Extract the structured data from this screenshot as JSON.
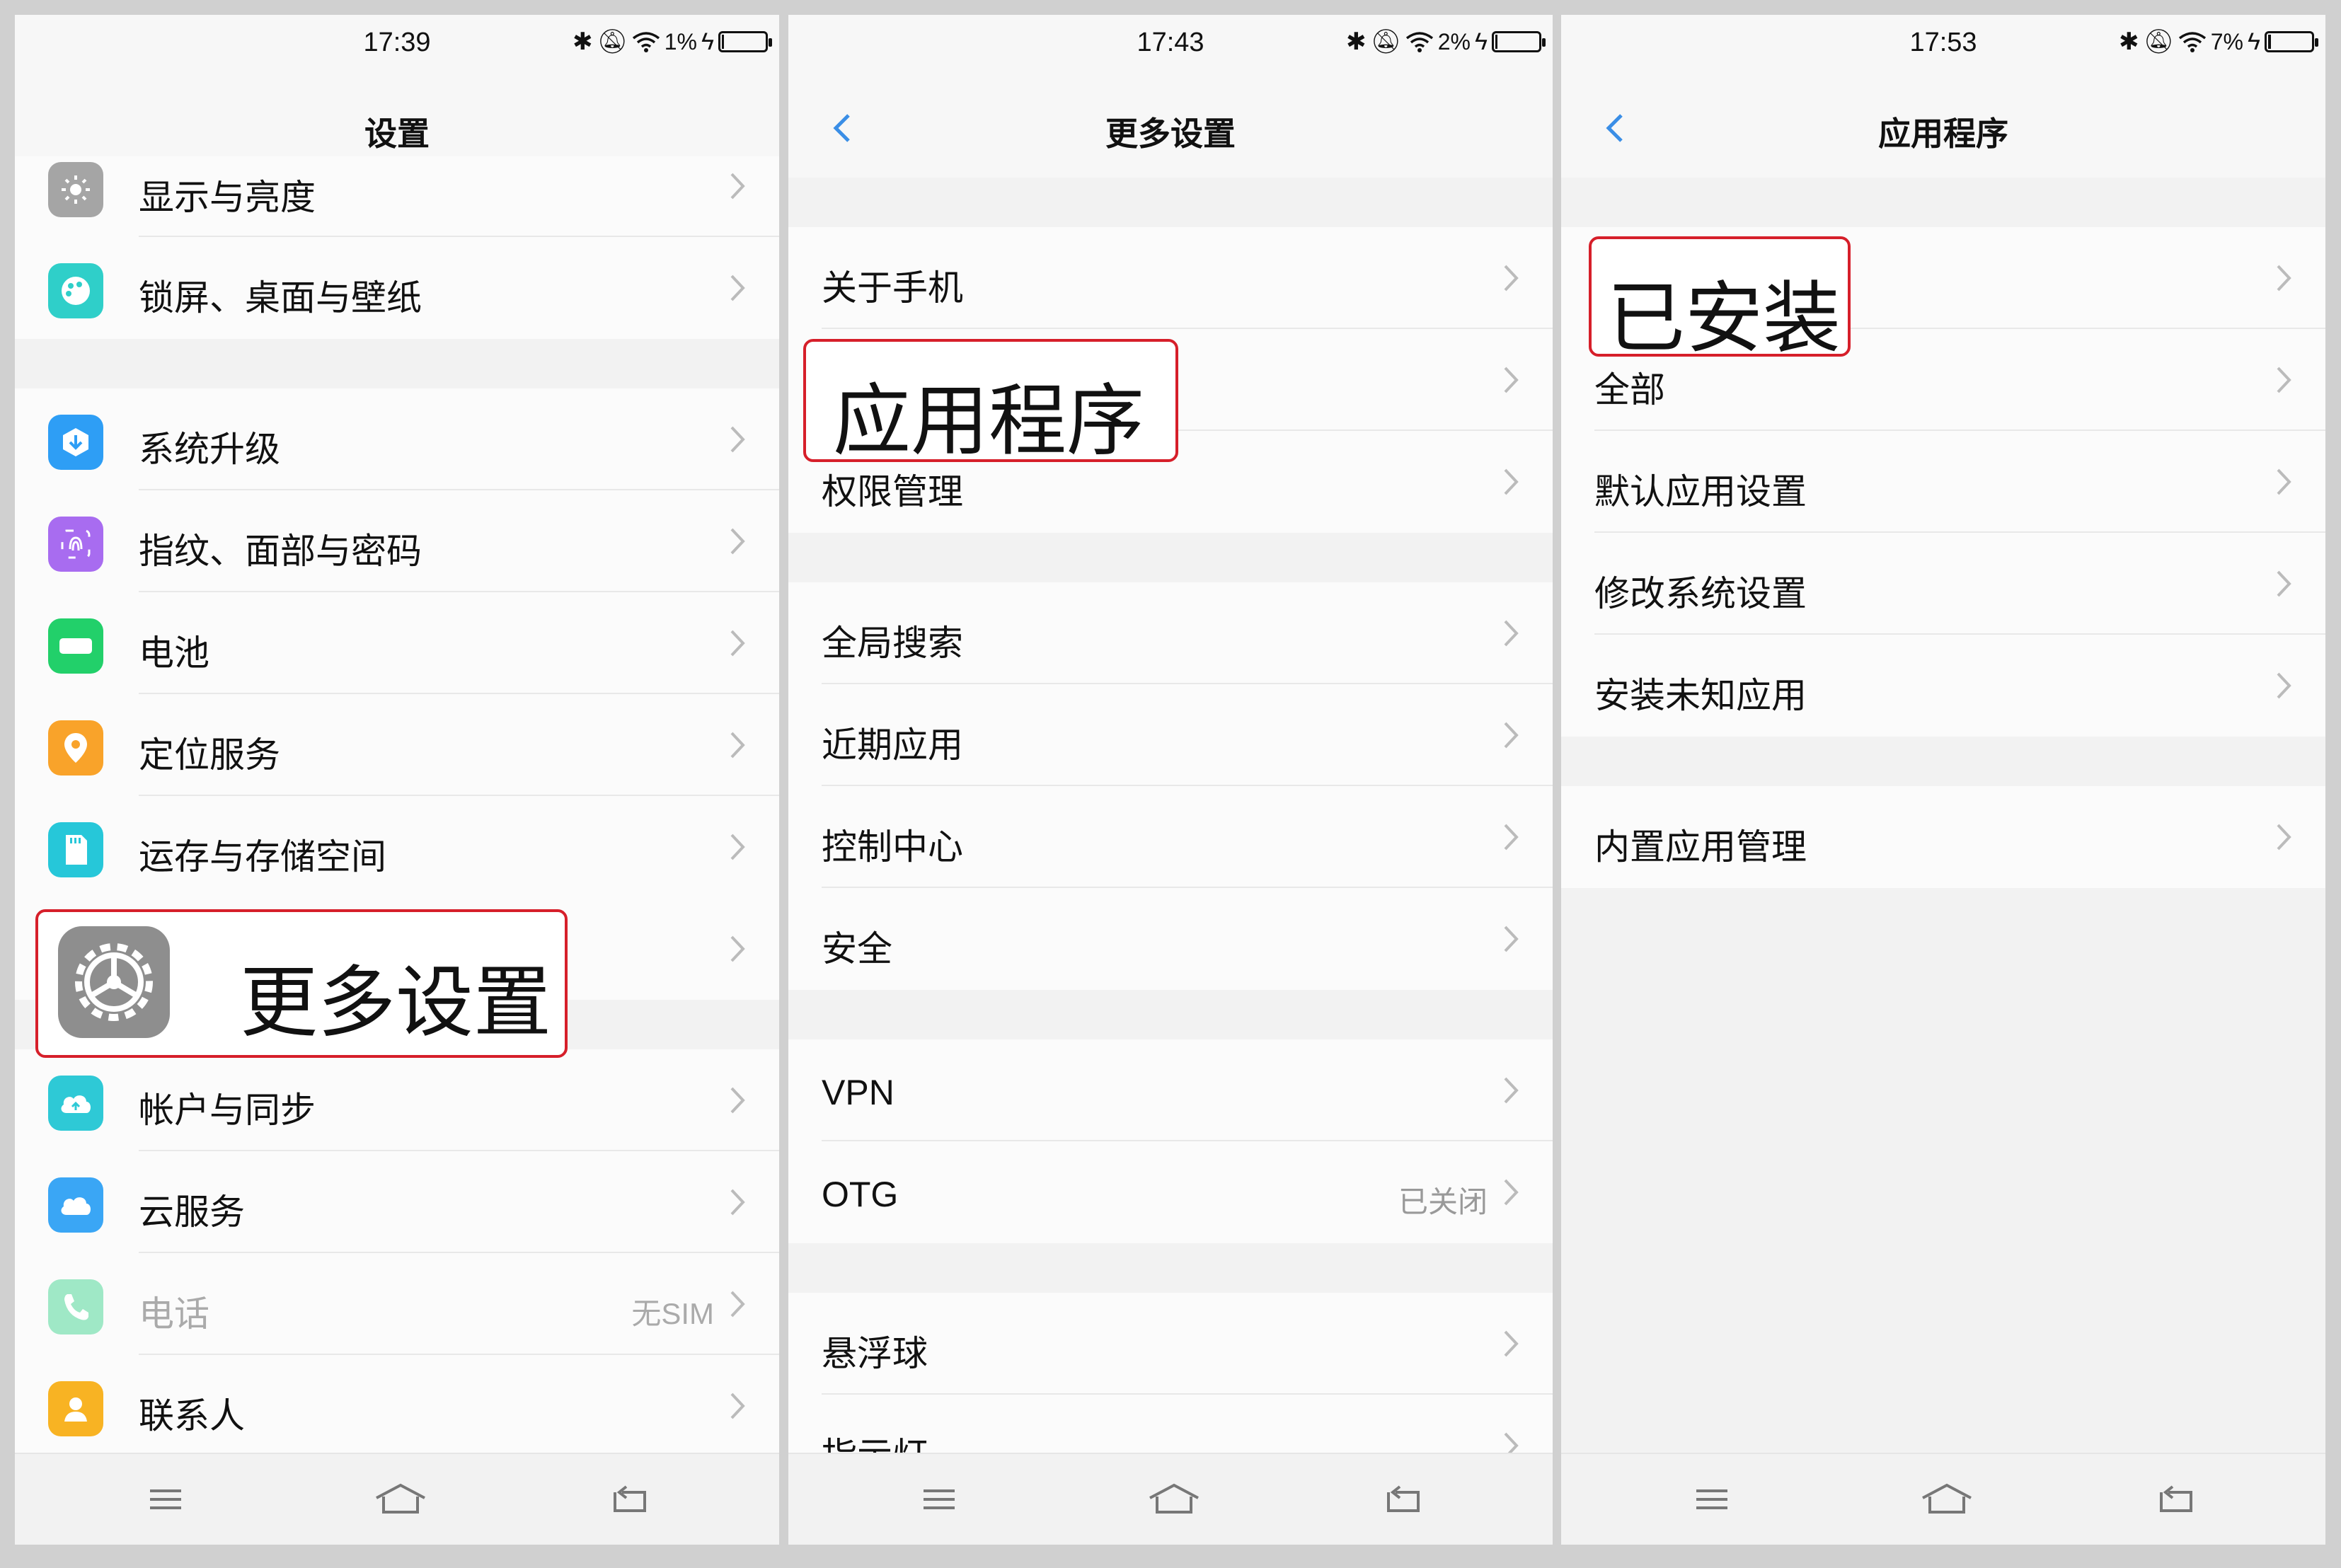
{
  "colors": {
    "accent": "#3a8ee6",
    "callout_border": "#d61f2a"
  },
  "panels": [
    {
      "status": {
        "time": "17:39",
        "battery": "1%",
        "battery_level": 0.01
      },
      "title": "设置",
      "rows": [
        {
          "label": "显示与亮度",
          "icon": "brightness-icon"
        },
        {
          "label": "锁屏、桌面与壁纸",
          "icon": "palette-icon"
        },
        {
          "label": "系统升级",
          "icon": "system-upgrade-icon"
        },
        {
          "label": "指纹、面部与密码",
          "icon": "fingerprint-icon"
        },
        {
          "label": "电池",
          "icon": "battery-icon"
        },
        {
          "label": "定位服务",
          "icon": "location-icon"
        },
        {
          "label": "运存与存储空间",
          "icon": "storage-icon"
        },
        {
          "label": "更多设置",
          "icon": "gear-icon"
        },
        {
          "label": "帐户与同步",
          "icon": "account-sync-icon"
        },
        {
          "label": "云服务",
          "icon": "cloud-icon"
        },
        {
          "label": "电话",
          "value": "无SIM",
          "icon": "phone-icon"
        },
        {
          "label": "联系人",
          "icon": "contacts-icon"
        }
      ],
      "callout": "更多设置"
    },
    {
      "status": {
        "time": "17:43",
        "battery": "2%",
        "battery_level": 0.02
      },
      "title": "更多设置",
      "rows": [
        {
          "label": "关于手机"
        },
        {
          "label": "应用程序"
        },
        {
          "label": "权限管理"
        },
        {
          "label": "全局搜索"
        },
        {
          "label": "近期应用"
        },
        {
          "label": "控制中心"
        },
        {
          "label": "安全"
        },
        {
          "label": "VPN"
        },
        {
          "label": "OTG",
          "value": "已关闭"
        },
        {
          "label": "悬浮球"
        },
        {
          "label": "指示灯"
        }
      ],
      "callout": "应用程序"
    },
    {
      "status": {
        "time": "17:53",
        "battery": "7%",
        "battery_level": 0.07
      },
      "title": "应用程序",
      "rows": [
        {
          "label": "已安装"
        },
        {
          "label": "全部"
        },
        {
          "label": "默认应用设置"
        },
        {
          "label": "修改系统设置"
        },
        {
          "label": "安装未知应用"
        },
        {
          "label": "内置应用管理"
        }
      ],
      "callout": "已安装"
    }
  ]
}
